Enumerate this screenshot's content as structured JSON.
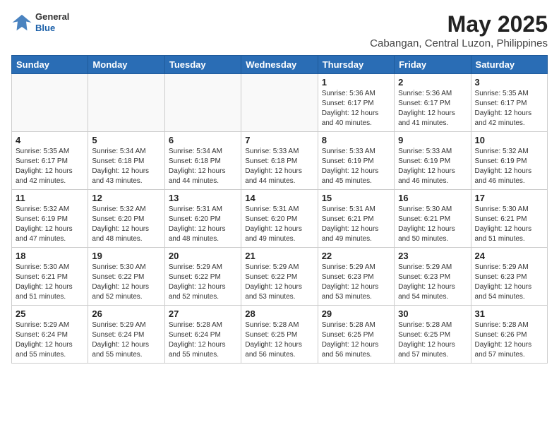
{
  "logo": {
    "general": "General",
    "blue": "Blue"
  },
  "title": "May 2025",
  "subtitle": "Cabangan, Central Luzon, Philippines",
  "weekdays": [
    "Sunday",
    "Monday",
    "Tuesday",
    "Wednesday",
    "Thursday",
    "Friday",
    "Saturday"
  ],
  "weeks": [
    [
      {
        "day": "",
        "info": ""
      },
      {
        "day": "",
        "info": ""
      },
      {
        "day": "",
        "info": ""
      },
      {
        "day": "",
        "info": ""
      },
      {
        "day": "1",
        "info": "Sunrise: 5:36 AM\nSunset: 6:17 PM\nDaylight: 12 hours\nand 40 minutes."
      },
      {
        "day": "2",
        "info": "Sunrise: 5:36 AM\nSunset: 6:17 PM\nDaylight: 12 hours\nand 41 minutes."
      },
      {
        "day": "3",
        "info": "Sunrise: 5:35 AM\nSunset: 6:17 PM\nDaylight: 12 hours\nand 42 minutes."
      }
    ],
    [
      {
        "day": "4",
        "info": "Sunrise: 5:35 AM\nSunset: 6:17 PM\nDaylight: 12 hours\nand 42 minutes."
      },
      {
        "day": "5",
        "info": "Sunrise: 5:34 AM\nSunset: 6:18 PM\nDaylight: 12 hours\nand 43 minutes."
      },
      {
        "day": "6",
        "info": "Sunrise: 5:34 AM\nSunset: 6:18 PM\nDaylight: 12 hours\nand 44 minutes."
      },
      {
        "day": "7",
        "info": "Sunrise: 5:33 AM\nSunset: 6:18 PM\nDaylight: 12 hours\nand 44 minutes."
      },
      {
        "day": "8",
        "info": "Sunrise: 5:33 AM\nSunset: 6:19 PM\nDaylight: 12 hours\nand 45 minutes."
      },
      {
        "day": "9",
        "info": "Sunrise: 5:33 AM\nSunset: 6:19 PM\nDaylight: 12 hours\nand 46 minutes."
      },
      {
        "day": "10",
        "info": "Sunrise: 5:32 AM\nSunset: 6:19 PM\nDaylight: 12 hours\nand 46 minutes."
      }
    ],
    [
      {
        "day": "11",
        "info": "Sunrise: 5:32 AM\nSunset: 6:19 PM\nDaylight: 12 hours\nand 47 minutes."
      },
      {
        "day": "12",
        "info": "Sunrise: 5:32 AM\nSunset: 6:20 PM\nDaylight: 12 hours\nand 48 minutes."
      },
      {
        "day": "13",
        "info": "Sunrise: 5:31 AM\nSunset: 6:20 PM\nDaylight: 12 hours\nand 48 minutes."
      },
      {
        "day": "14",
        "info": "Sunrise: 5:31 AM\nSunset: 6:20 PM\nDaylight: 12 hours\nand 49 minutes."
      },
      {
        "day": "15",
        "info": "Sunrise: 5:31 AM\nSunset: 6:21 PM\nDaylight: 12 hours\nand 49 minutes."
      },
      {
        "day": "16",
        "info": "Sunrise: 5:30 AM\nSunset: 6:21 PM\nDaylight: 12 hours\nand 50 minutes."
      },
      {
        "day": "17",
        "info": "Sunrise: 5:30 AM\nSunset: 6:21 PM\nDaylight: 12 hours\nand 51 minutes."
      }
    ],
    [
      {
        "day": "18",
        "info": "Sunrise: 5:30 AM\nSunset: 6:21 PM\nDaylight: 12 hours\nand 51 minutes."
      },
      {
        "day": "19",
        "info": "Sunrise: 5:30 AM\nSunset: 6:22 PM\nDaylight: 12 hours\nand 52 minutes."
      },
      {
        "day": "20",
        "info": "Sunrise: 5:29 AM\nSunset: 6:22 PM\nDaylight: 12 hours\nand 52 minutes."
      },
      {
        "day": "21",
        "info": "Sunrise: 5:29 AM\nSunset: 6:22 PM\nDaylight: 12 hours\nand 53 minutes."
      },
      {
        "day": "22",
        "info": "Sunrise: 5:29 AM\nSunset: 6:23 PM\nDaylight: 12 hours\nand 53 minutes."
      },
      {
        "day": "23",
        "info": "Sunrise: 5:29 AM\nSunset: 6:23 PM\nDaylight: 12 hours\nand 54 minutes."
      },
      {
        "day": "24",
        "info": "Sunrise: 5:29 AM\nSunset: 6:23 PM\nDaylight: 12 hours\nand 54 minutes."
      }
    ],
    [
      {
        "day": "25",
        "info": "Sunrise: 5:29 AM\nSunset: 6:24 PM\nDaylight: 12 hours\nand 55 minutes."
      },
      {
        "day": "26",
        "info": "Sunrise: 5:29 AM\nSunset: 6:24 PM\nDaylight: 12 hours\nand 55 minutes."
      },
      {
        "day": "27",
        "info": "Sunrise: 5:28 AM\nSunset: 6:24 PM\nDaylight: 12 hours\nand 55 minutes."
      },
      {
        "day": "28",
        "info": "Sunrise: 5:28 AM\nSunset: 6:25 PM\nDaylight: 12 hours\nand 56 minutes."
      },
      {
        "day": "29",
        "info": "Sunrise: 5:28 AM\nSunset: 6:25 PM\nDaylight: 12 hours\nand 56 minutes."
      },
      {
        "day": "30",
        "info": "Sunrise: 5:28 AM\nSunset: 6:25 PM\nDaylight: 12 hours\nand 57 minutes."
      },
      {
        "day": "31",
        "info": "Sunrise: 5:28 AM\nSunset: 6:26 PM\nDaylight: 12 hours\nand 57 minutes."
      }
    ]
  ]
}
